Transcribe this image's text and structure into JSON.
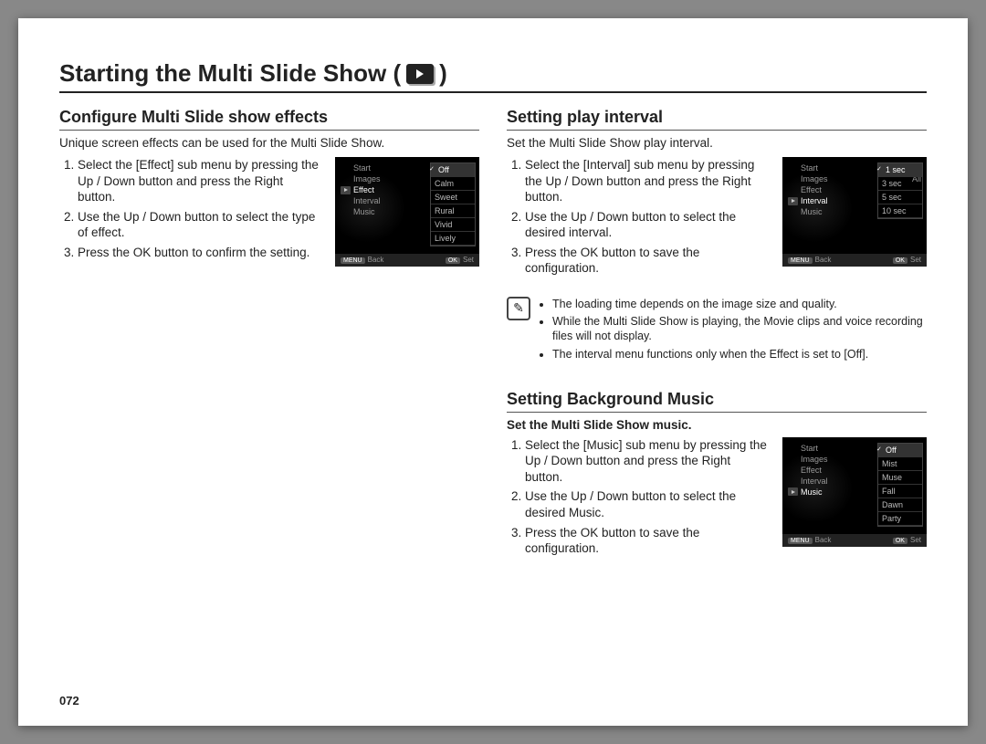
{
  "title": "Starting the Multi Slide Show (",
  "title_close": " )",
  "page_number": "072",
  "left": {
    "heading": "Configure Multi Slide show effects",
    "intro": "Unique screen effects can be used for the Multi Slide Show.",
    "steps": [
      "Select the [Effect] sub menu by pressing the Up / Down button and press the Right button.",
      "Use the Up / Down button to select the type of effect.",
      "Press the OK button to confirm the setting."
    ],
    "thumb": {
      "menu": [
        "Start",
        "Images",
        "Effect",
        "Interval",
        "Music"
      ],
      "selected": "Effect",
      "options": [
        "Off",
        "Calm",
        "Sweet",
        "Rural",
        "Vivid",
        "Lively"
      ],
      "opt_selected": "Off",
      "footer_left_key": "MENU",
      "footer_left": "Back",
      "footer_right_key": "OK",
      "footer_right": "Set"
    }
  },
  "right_top": {
    "heading": "Setting play interval",
    "intro": "Set the Multi Slide Show play interval.",
    "steps": [
      "Select the [Interval] sub menu by pressing the Up / Down button and press the Right button.",
      "Use the Up / Down button to select the desired interval.",
      "Press the OK button to save the configuration."
    ],
    "thumb": {
      "menu": [
        "Start",
        "Images",
        "Effect",
        "Interval",
        "Music"
      ],
      "selected": "Interval",
      "right_label": "All",
      "options": [
        "1 sec",
        "3 sec",
        "5 sec",
        "10 sec"
      ],
      "opt_selected": "1 sec",
      "footer_left_key": "MENU",
      "footer_left": "Back",
      "footer_right_key": "OK",
      "footer_right": "Set"
    },
    "notes": [
      "The loading time depends on the image size and quality.",
      "While the Multi Slide Show is playing, the Movie clips and voice recording files will not display.",
      "The interval menu functions only when the Effect is set to [Off]."
    ]
  },
  "right_bottom": {
    "heading": "Setting Background Music",
    "bold_intro": "Set the Multi Slide Show music.",
    "steps": [
      "Select the [Music] sub menu by pressing the Up / Down button and press the Right button.",
      "Use the Up / Down button to select the desired Music.",
      "Press the OK button to save the configuration."
    ],
    "thumb": {
      "menu": [
        "Start",
        "Images",
        "Effect",
        "Interval",
        "Music"
      ],
      "selected": "Music",
      "options": [
        "Off",
        "Mist",
        "Muse",
        "Fall",
        "Dawn",
        "Party"
      ],
      "opt_selected": "Off",
      "footer_left_key": "MENU",
      "footer_left": "Back",
      "footer_right_key": "OK",
      "footer_right": "Set"
    }
  }
}
